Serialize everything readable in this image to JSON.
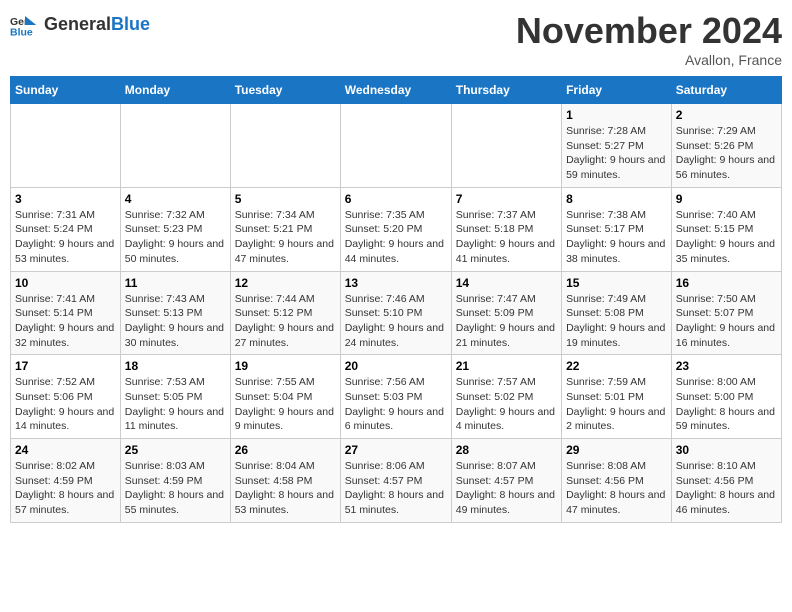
{
  "logo": {
    "text_general": "General",
    "text_blue": "Blue"
  },
  "title": "November 2024",
  "location": "Avallon, France",
  "days_of_week": [
    "Sunday",
    "Monday",
    "Tuesday",
    "Wednesday",
    "Thursday",
    "Friday",
    "Saturday"
  ],
  "weeks": [
    [
      null,
      null,
      null,
      null,
      null,
      {
        "day": "1",
        "sunrise": "7:28 AM",
        "sunset": "5:27 PM",
        "daylight": "9 hours and 59 minutes."
      },
      {
        "day": "2",
        "sunrise": "7:29 AM",
        "sunset": "5:26 PM",
        "daylight": "9 hours and 56 minutes."
      }
    ],
    [
      {
        "day": "3",
        "sunrise": "7:31 AM",
        "sunset": "5:24 PM",
        "daylight": "9 hours and 53 minutes."
      },
      {
        "day": "4",
        "sunrise": "7:32 AM",
        "sunset": "5:23 PM",
        "daylight": "9 hours and 50 minutes."
      },
      {
        "day": "5",
        "sunrise": "7:34 AM",
        "sunset": "5:21 PM",
        "daylight": "9 hours and 47 minutes."
      },
      {
        "day": "6",
        "sunrise": "7:35 AM",
        "sunset": "5:20 PM",
        "daylight": "9 hours and 44 minutes."
      },
      {
        "day": "7",
        "sunrise": "7:37 AM",
        "sunset": "5:18 PM",
        "daylight": "9 hours and 41 minutes."
      },
      {
        "day": "8",
        "sunrise": "7:38 AM",
        "sunset": "5:17 PM",
        "daylight": "9 hours and 38 minutes."
      },
      {
        "day": "9",
        "sunrise": "7:40 AM",
        "sunset": "5:15 PM",
        "daylight": "9 hours and 35 minutes."
      }
    ],
    [
      {
        "day": "10",
        "sunrise": "7:41 AM",
        "sunset": "5:14 PM",
        "daylight": "9 hours and 32 minutes."
      },
      {
        "day": "11",
        "sunrise": "7:43 AM",
        "sunset": "5:13 PM",
        "daylight": "9 hours and 30 minutes."
      },
      {
        "day": "12",
        "sunrise": "7:44 AM",
        "sunset": "5:12 PM",
        "daylight": "9 hours and 27 minutes."
      },
      {
        "day": "13",
        "sunrise": "7:46 AM",
        "sunset": "5:10 PM",
        "daylight": "9 hours and 24 minutes."
      },
      {
        "day": "14",
        "sunrise": "7:47 AM",
        "sunset": "5:09 PM",
        "daylight": "9 hours and 21 minutes."
      },
      {
        "day": "15",
        "sunrise": "7:49 AM",
        "sunset": "5:08 PM",
        "daylight": "9 hours and 19 minutes."
      },
      {
        "day": "16",
        "sunrise": "7:50 AM",
        "sunset": "5:07 PM",
        "daylight": "9 hours and 16 minutes."
      }
    ],
    [
      {
        "day": "17",
        "sunrise": "7:52 AM",
        "sunset": "5:06 PM",
        "daylight": "9 hours and 14 minutes."
      },
      {
        "day": "18",
        "sunrise": "7:53 AM",
        "sunset": "5:05 PM",
        "daylight": "9 hours and 11 minutes."
      },
      {
        "day": "19",
        "sunrise": "7:55 AM",
        "sunset": "5:04 PM",
        "daylight": "9 hours and 9 minutes."
      },
      {
        "day": "20",
        "sunrise": "7:56 AM",
        "sunset": "5:03 PM",
        "daylight": "9 hours and 6 minutes."
      },
      {
        "day": "21",
        "sunrise": "7:57 AM",
        "sunset": "5:02 PM",
        "daylight": "9 hours and 4 minutes."
      },
      {
        "day": "22",
        "sunrise": "7:59 AM",
        "sunset": "5:01 PM",
        "daylight": "9 hours and 2 minutes."
      },
      {
        "day": "23",
        "sunrise": "8:00 AM",
        "sunset": "5:00 PM",
        "daylight": "8 hours and 59 minutes."
      }
    ],
    [
      {
        "day": "24",
        "sunrise": "8:02 AM",
        "sunset": "4:59 PM",
        "daylight": "8 hours and 57 minutes."
      },
      {
        "day": "25",
        "sunrise": "8:03 AM",
        "sunset": "4:59 PM",
        "daylight": "8 hours and 55 minutes."
      },
      {
        "day": "26",
        "sunrise": "8:04 AM",
        "sunset": "4:58 PM",
        "daylight": "8 hours and 53 minutes."
      },
      {
        "day": "27",
        "sunrise": "8:06 AM",
        "sunset": "4:57 PM",
        "daylight": "8 hours and 51 minutes."
      },
      {
        "day": "28",
        "sunrise": "8:07 AM",
        "sunset": "4:57 PM",
        "daylight": "8 hours and 49 minutes."
      },
      {
        "day": "29",
        "sunrise": "8:08 AM",
        "sunset": "4:56 PM",
        "daylight": "8 hours and 47 minutes."
      },
      {
        "day": "30",
        "sunrise": "8:10 AM",
        "sunset": "4:56 PM",
        "daylight": "8 hours and 46 minutes."
      }
    ]
  ]
}
